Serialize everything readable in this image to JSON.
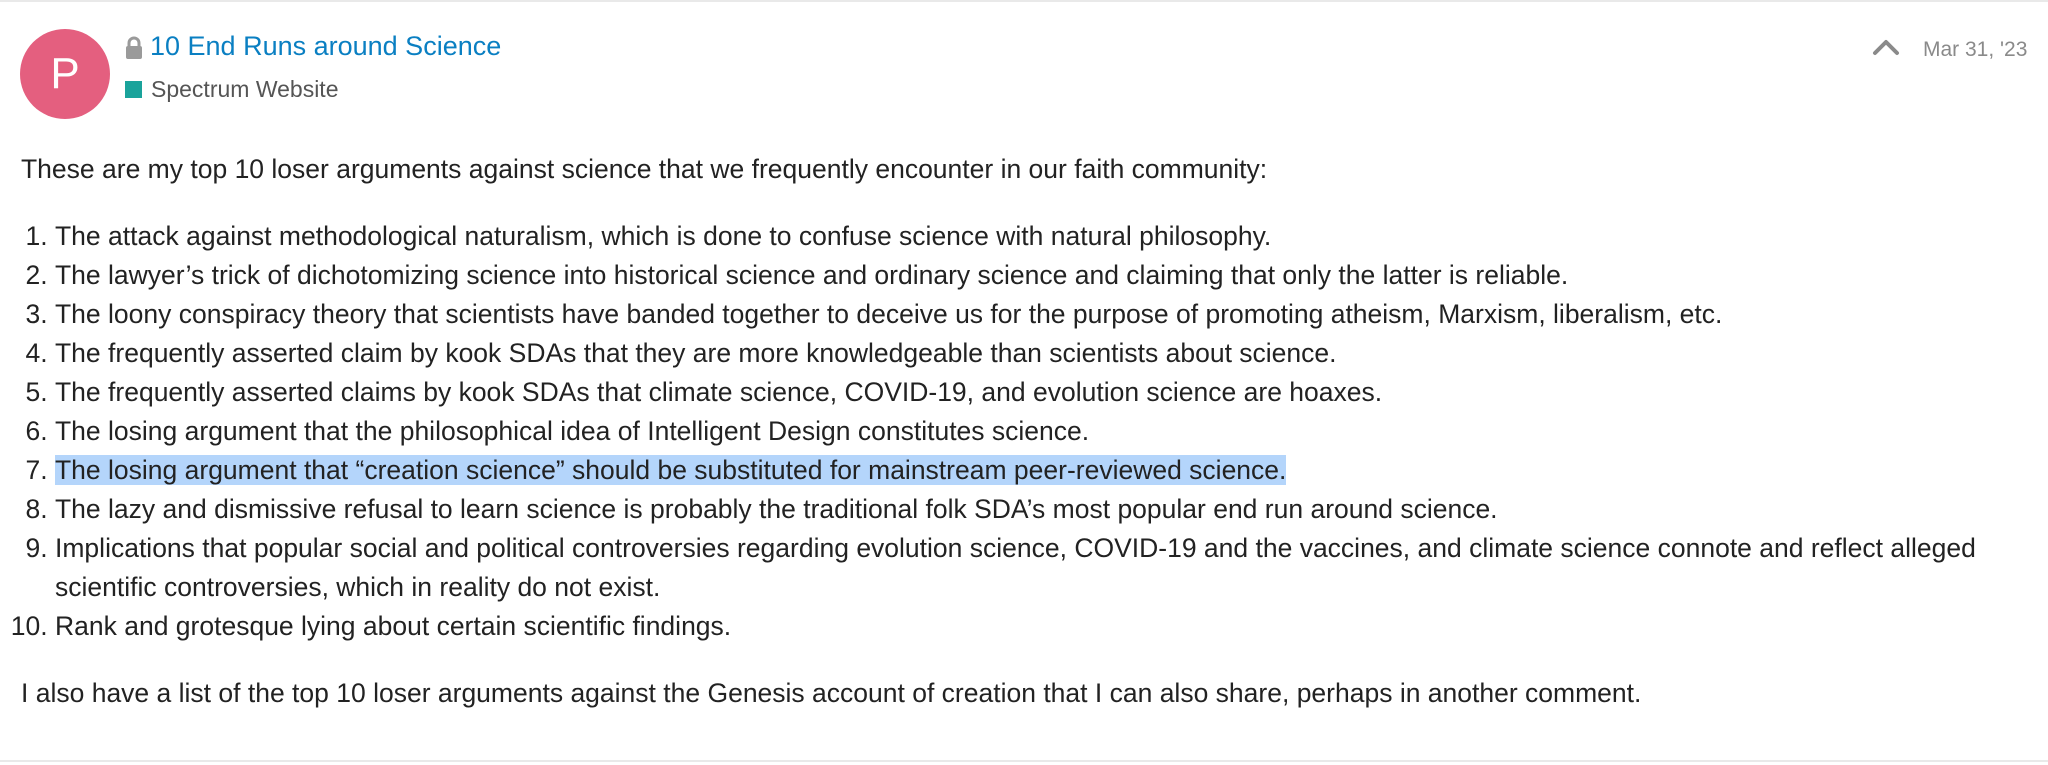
{
  "post": {
    "avatar_letter": "P",
    "avatar_color": "#e45f7f",
    "topic_title": "10 End Runs around Science",
    "category": "Spectrum Website",
    "category_color": "#1aa39b",
    "date": "Mar 31, '23",
    "icons": [
      "lock-icon",
      "chevron-up-icon"
    ]
  },
  "content": {
    "intro": "These are my top 10 loser arguments against science that we frequently encounter in our faith community:",
    "items": [
      "The attack against methodological naturalism, which is done to confuse science with natural philosophy.",
      "The lawyer’s trick of dichotomizing science into historical science and ordinary science and claiming that only the latter is reliable.",
      "The loony conspiracy theory that scientists have banded together to deceive us for the purpose of promoting atheism, Marxism, liberalism, etc.",
      "The frequently asserted claim by kook SDAs that they are more knowledgeable than scientists about science.",
      "The frequently asserted claims by kook SDAs that climate science, COVID-19, and evolution science are hoaxes.",
      "The losing argument that the philosophical idea of Intelligent Design constitutes science.",
      "The losing argument that “creation science” should be substituted for mainstream peer-reviewed science.",
      "The lazy and dismissive refusal to learn science is probably the traditional folk SDA’s most popular end run around science.",
      "Implications that popular social and political controversies regarding evolution science, COVID-19 and the vaccines, and climate science connote and reflect alleged scientific controversies, which in reality do not exist.",
      "Rank and grotesque lying about certain scientific findings."
    ],
    "highlight_color": "#b4d5fb",
    "outro": "I also have a list of the top 10 loser arguments against the Genesis account of creation that I can also share, perhaps in another comment."
  }
}
